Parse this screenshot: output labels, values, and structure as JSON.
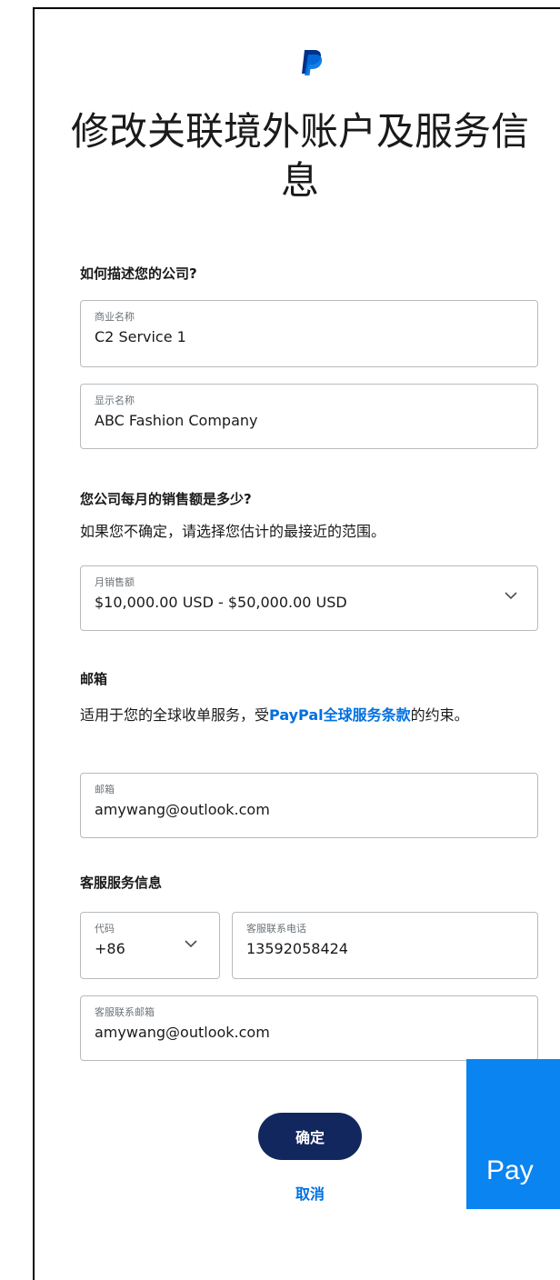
{
  "page": {
    "title": "修改关联境外账户及服务信息"
  },
  "company_section": {
    "title": "如何描述您的公司?",
    "business_name": {
      "label": "商业名称",
      "value": "C2 Service 1"
    },
    "display_name": {
      "label": "显示名称",
      "value": "ABC Fashion Company"
    }
  },
  "sales_section": {
    "title": "您公司每月的销售额是多少?",
    "description": "如果您不确定，请选择您估计的最接近的范围。",
    "monthly_sales": {
      "label": "月销售额",
      "value": "$10,000.00 USD - $50,000.00 USD"
    }
  },
  "email_section": {
    "title": "邮箱",
    "desc_before": "适用于您的全球收单服务，受",
    "desc_link": "PayPal全球服务条款",
    "desc_after": "的约束。",
    "email": {
      "label": "邮箱",
      "value": "amywang@outlook.com"
    }
  },
  "support_section": {
    "title": "客服服务信息",
    "code": {
      "label": "代码",
      "value": "+86"
    },
    "phone": {
      "label": "客服联系电话",
      "value": "13592058424"
    },
    "email": {
      "label": "客服联系邮箱",
      "value": "amywang@outlook.com"
    }
  },
  "actions": {
    "confirm": "确定",
    "cancel": "取消"
  },
  "overlay": {
    "text": "Pay"
  },
  "colors": {
    "link": "#0070e0",
    "primary_button": "#13275f",
    "overlay": "#0a84f0"
  }
}
